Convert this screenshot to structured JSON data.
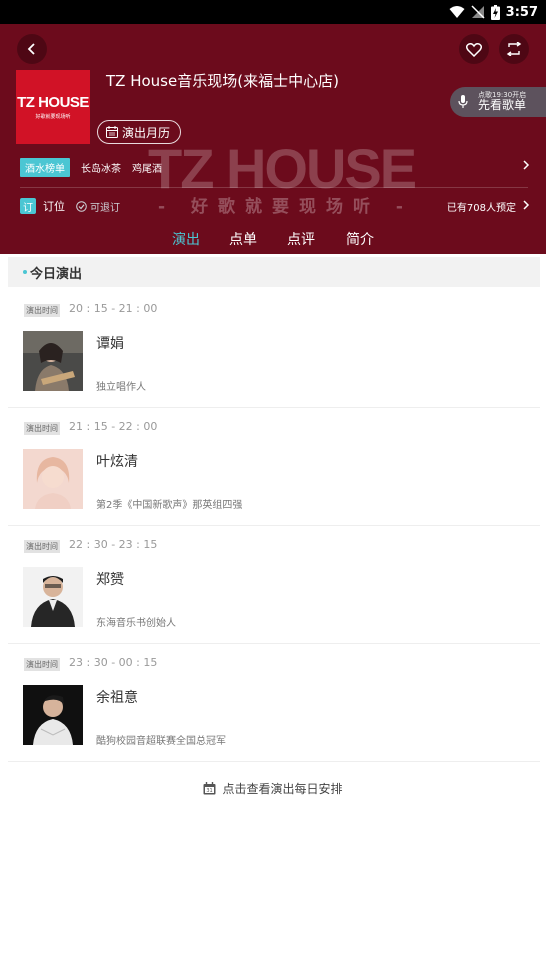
{
  "status_bar": {
    "time": "3:57"
  },
  "header": {
    "venue_name": "TZ House音乐现场(来福士中心店)",
    "logo_text": "TZ HOUSE",
    "logo_subtext": "好歌就要现场听",
    "watermark_logo": "TZ HOUSE",
    "watermark_slogan": "- 好歌就要现场听 -",
    "song_pill_note": "点歌19:30开启",
    "song_pill_label": "先看歌单",
    "calendar_label": "演出月历",
    "drinks": {
      "badge": "酒水榜单",
      "items": [
        "长岛冰茶",
        "鸡尾酒"
      ]
    },
    "booking": {
      "icon": "订",
      "label": "订位",
      "refund": "可退订",
      "booked_count": "已有708人预定"
    }
  },
  "tabs": [
    "演出",
    "点单",
    "点评",
    "简介"
  ],
  "active_tab": "演出",
  "section_title": "今日演出",
  "time_badge_label": "演出时间",
  "shows": [
    {
      "time": "20 : 15 - 21 : 00",
      "name": "谭娟",
      "desc": "独立唱作人"
    },
    {
      "time": "21 : 15 - 22 : 00",
      "name": "叶炫清",
      "desc": "第2季《中国新歌声》那英组四强"
    },
    {
      "time": "22 : 30 - 23 : 15",
      "name": "郑赟",
      "desc": "东海音乐书创始人"
    },
    {
      "time": "23 : 30 - 00 : 15",
      "name": "余祖意",
      "desc": "酷狗校园音超联赛全国总冠军"
    }
  ],
  "schedule_link": "点击查看演出每日安排",
  "colors": {
    "header_bg": "#6c0b1c",
    "accent": "#4bc6d3",
    "logo_red": "#d11226"
  }
}
